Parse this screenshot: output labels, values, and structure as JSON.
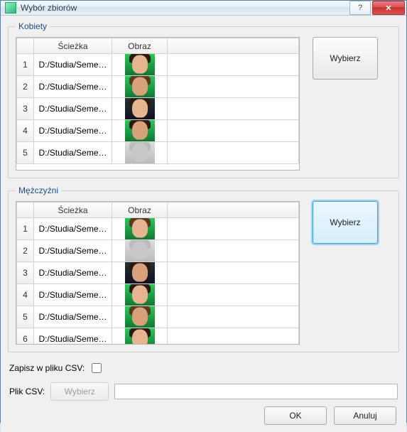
{
  "window": {
    "title": "Wybór zbiorów"
  },
  "groups": {
    "women": {
      "legend": "Kobiety",
      "select_label": "Wybierz",
      "columns": {
        "path": "Ścieżka",
        "image": "Obraz"
      },
      "rows": [
        {
          "n": "1",
          "path": "D:/Studia/Seme…"
        },
        {
          "n": "2",
          "path": "D:/Studia/Seme…"
        },
        {
          "n": "3",
          "path": "D:/Studia/Seme…"
        },
        {
          "n": "4",
          "path": "D:/Studia/Seme…"
        },
        {
          "n": "5",
          "path": "D:/Studia/Seme…"
        }
      ]
    },
    "men": {
      "legend": "Mężczyźni",
      "select_label": "Wybierz",
      "columns": {
        "path": "Ścieżka",
        "image": "Obraz"
      },
      "rows": [
        {
          "n": "1",
          "path": "D:/Studia/Seme…"
        },
        {
          "n": "2",
          "path": "D:/Studia/Seme…"
        },
        {
          "n": "3",
          "path": "D:/Studia/Seme…"
        },
        {
          "n": "4",
          "path": "D:/Studia/Seme…"
        },
        {
          "n": "5",
          "path": "D:/Studia/Seme…"
        },
        {
          "n": "6",
          "path": "D:/Studia/Seme…"
        }
      ]
    }
  },
  "csv": {
    "save_label": "Zapisz w pliku CSV:",
    "file_label": "Plik CSV:",
    "browse_label": "Wybierz",
    "path": ""
  },
  "footer": {
    "ok": "OK",
    "cancel": "Anuluj"
  },
  "titlebar": {
    "help": "?",
    "close": "✕"
  }
}
